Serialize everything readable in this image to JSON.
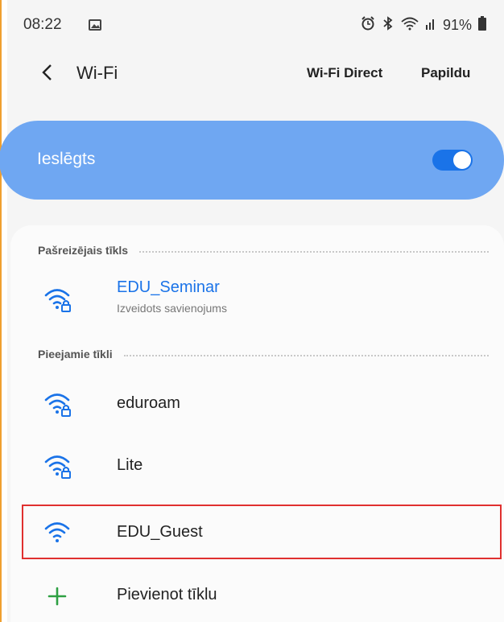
{
  "status_bar": {
    "time": "08:22",
    "battery": "91%"
  },
  "header": {
    "title": "Wi-Fi",
    "wifi_direct": "Wi-Fi Direct",
    "more": "Papildu"
  },
  "toggle": {
    "label": "Ieslēgts",
    "state": "on"
  },
  "sections": {
    "current": "Pašreizējais tīkls",
    "available": "Pieejamie tīkli"
  },
  "current_network": {
    "name": "EDU_Seminar",
    "status": "Izveidots savienojums",
    "secured": true
  },
  "available_networks": [
    {
      "name": "eduroam",
      "secured": true
    },
    {
      "name": "Lite",
      "secured": true
    },
    {
      "name": "EDU_Guest",
      "secured": false
    }
  ],
  "add_network": {
    "label": "Pievienot tīklu"
  },
  "colors": {
    "accent": "#1a73e8",
    "toggle_card": "#6fa7f2",
    "add_icon": "#2ea043",
    "highlight": "#e0302f"
  }
}
